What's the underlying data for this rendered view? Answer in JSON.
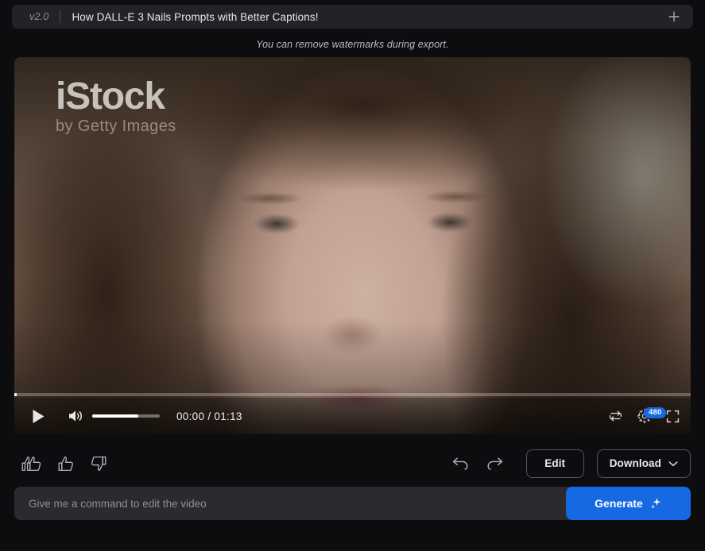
{
  "header": {
    "version_tag": "v2.0",
    "title": "How DALL-E 3 Nails Prompts with Better Captions!",
    "add_icon": "plus-icon"
  },
  "notice": {
    "text": "You can remove watermarks during export."
  },
  "player": {
    "watermark_main": "iStock",
    "watermark_sub": "by Getty Images",
    "current_time": "00:00",
    "duration": "01:13",
    "timecode": "00:00 / 01:13",
    "progress_percent": 0,
    "volume_percent": 68,
    "controls": {
      "play": "play-icon",
      "volume": "volume-icon",
      "loop": "loop-icon",
      "settings": "gear-icon",
      "fullscreen": "fullscreen-icon"
    },
    "resolution_badge": "480"
  },
  "actions": {
    "super_like": "double-thumbs-up-icon",
    "like": "thumbs-up-icon",
    "dislike": "thumbs-down-icon",
    "undo": "undo-icon",
    "redo": "redo-icon",
    "edit_label": "Edit",
    "download_label": "Download",
    "download_chevron": "chevron-down-icon"
  },
  "command": {
    "placeholder": "Give me a command to edit the video",
    "value": "",
    "generate_label": "Generate",
    "generate_icon": "sparkle-icon"
  },
  "colors": {
    "accent_blue": "#1668e3",
    "page_bg": "#0d0d0f",
    "panel_bg": "#2b2b2f",
    "header_bg": "#232327"
  }
}
